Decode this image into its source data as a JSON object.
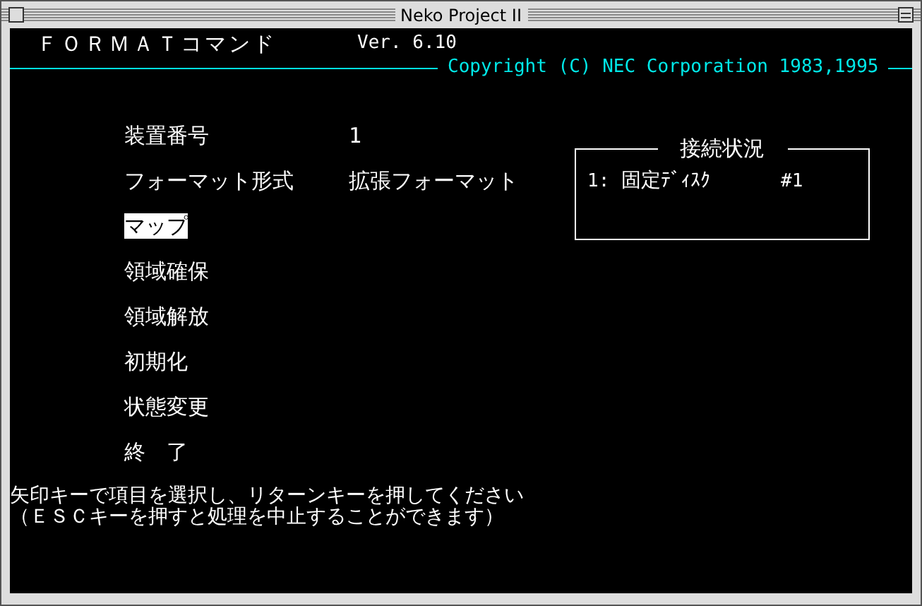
{
  "window": {
    "title": "Neko Project II"
  },
  "header": {
    "title": "ＦＯＲＭＡＴコマンド",
    "version": "Ver. 6.10",
    "copyright": "Copyright (C) NEC Corporation 1983,1995"
  },
  "fields": [
    {
      "label": "装置番号",
      "value": "1"
    },
    {
      "label": "フォーマット形式",
      "value": "拡張フォーマット"
    }
  ],
  "menu": [
    {
      "label": "マップ",
      "selected": true
    },
    {
      "label": "領域確保",
      "selected": false
    },
    {
      "label": "領域解放",
      "selected": false
    },
    {
      "label": "初期化",
      "selected": false
    },
    {
      "label": "状態変更",
      "selected": false
    },
    {
      "label": "終　了",
      "selected": false
    }
  ],
  "connection": {
    "title": "接続状況",
    "entries": [
      {
        "number": "1:",
        "device": "固定ﾃﾞｨｽｸ",
        "id": "#1"
      }
    ]
  },
  "instructions": [
    "矢印キーで項目を選択し、リターンキーを押してください",
    "（ＥＳＣキーを押すと処理を中止することができます）"
  ]
}
